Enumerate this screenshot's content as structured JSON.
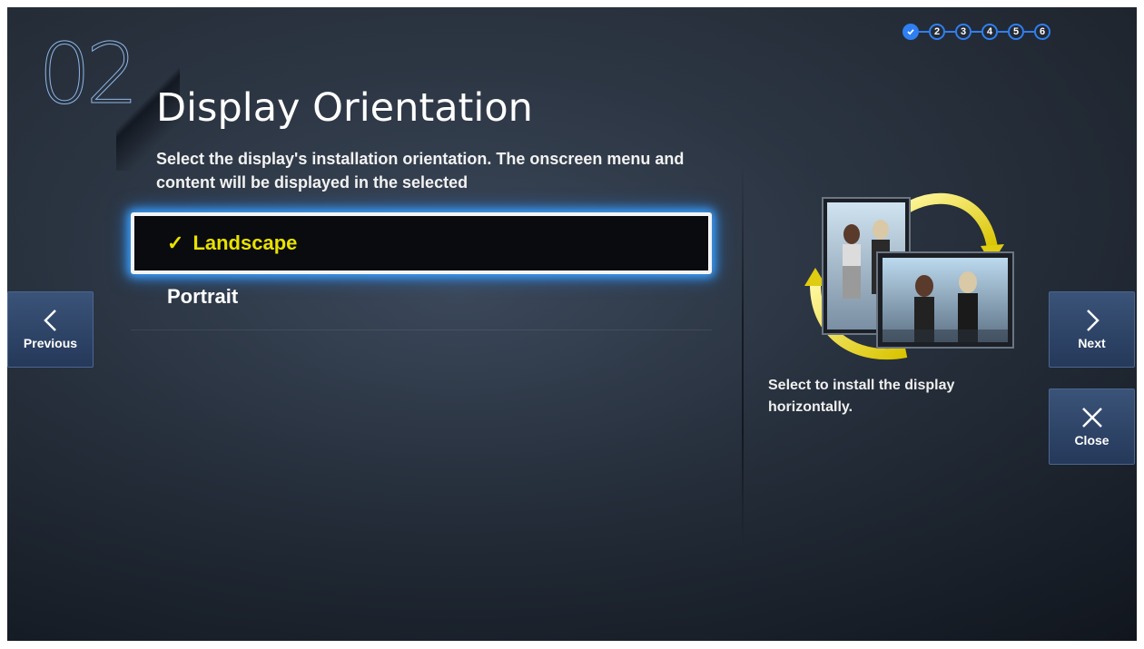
{
  "header": {
    "step_number": "02",
    "title": "Display Orientation",
    "description": "Select the display's installation orientation. The onscreen menu and content will be displayed in the selected"
  },
  "progress": {
    "current_step": 2,
    "total_steps": 6,
    "steps": [
      "",
      "2",
      "3",
      "4",
      "5",
      "6"
    ]
  },
  "options": [
    {
      "label": "Landscape",
      "selected": true,
      "check": "✓"
    },
    {
      "label": "Portrait",
      "selected": false
    }
  ],
  "help_text": "Select to install the display horizontally.",
  "nav": {
    "previous_label": "Previous",
    "next_label": "Next",
    "close_label": "Close"
  },
  "colors": {
    "selected_text": "#e8e200",
    "focus_glow": "#3da3ff",
    "step_accent": "#2f7ff0",
    "nav_button": "#2f4668"
  },
  "icons": {
    "previous": "chevron-left-icon",
    "next": "chevron-right-icon",
    "close": "close-icon",
    "check": "checkmark-icon",
    "illustration": "rotate-display-illustration"
  }
}
